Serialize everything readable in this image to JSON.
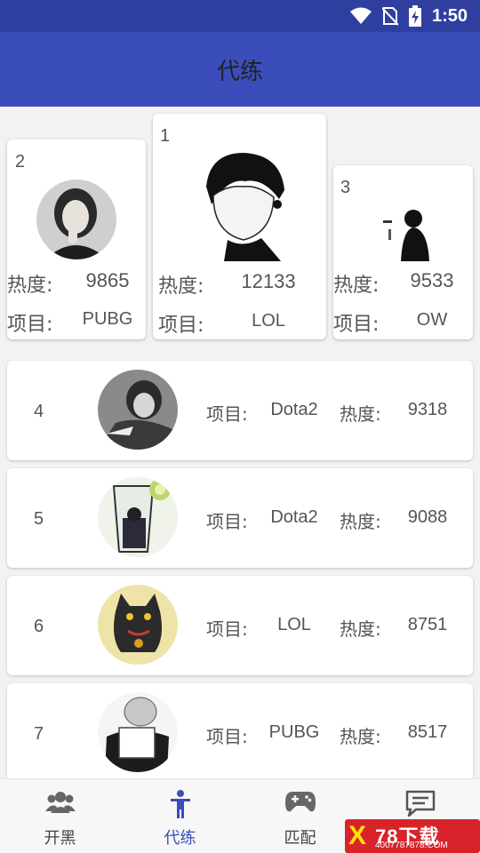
{
  "status_bar": {
    "time": "1:50"
  },
  "header": {
    "title": "代练"
  },
  "labels": {
    "heat": "热度:",
    "project": "项目:"
  },
  "podium": [
    {
      "rank": "2",
      "heat": "9865",
      "project": "PUBG"
    },
    {
      "rank": "1",
      "heat": "12133",
      "project": "LOL"
    },
    {
      "rank": "3",
      "heat": "9533",
      "project": "OW"
    }
  ],
  "list": [
    {
      "rank": "4",
      "project": "Dota2",
      "heat": "9318"
    },
    {
      "rank": "5",
      "project": "Dota2",
      "heat": "9088"
    },
    {
      "rank": "6",
      "project": "LOL",
      "heat": "8751"
    },
    {
      "rank": "7",
      "project": "PUBG",
      "heat": "8517"
    }
  ],
  "bottom_nav": [
    {
      "label": "开黑",
      "icon": "group-icon"
    },
    {
      "label": "代练",
      "icon": "person-icon",
      "active": true
    },
    {
      "label": "匹配",
      "icon": "gamepad-icon"
    },
    {
      "label": "",
      "icon": "chat-icon"
    }
  ],
  "watermark": {
    "main": "78下载",
    "sub": "4007787878.COM",
    "mark": "X"
  },
  "colors": {
    "status_bar": "#2f3fa0",
    "app_bar": "#3a4dbb",
    "accent": "#3a4dbb",
    "watermark": "#d8232a"
  }
}
